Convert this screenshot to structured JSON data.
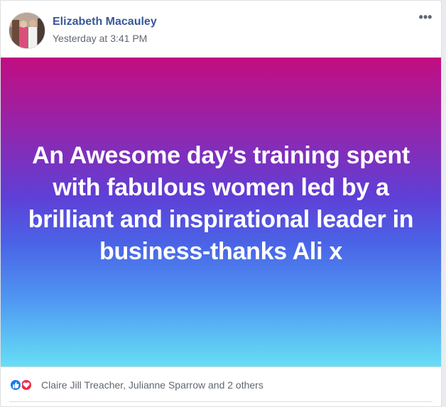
{
  "post": {
    "author": "Elizabeth Macauley",
    "timestamp": "Yesterday at 3:41 PM",
    "more_icon": "ellipsis-icon",
    "more_label": "•••",
    "status_text": "An Awesome day’s training spent with fabulous women led by a brilliant and inspirational leader in business-thanks Ali x",
    "background_gradient": [
      "#c20d80",
      "#5f3fd6",
      "#66dff5"
    ],
    "text_color": "#ffffff"
  },
  "reactions": {
    "icons": [
      "like-icon",
      "love-icon"
    ],
    "colors": {
      "like": "#1877f2",
      "love": "#f0284a"
    },
    "summary": "Claire Jill Treacher, Julianne Sparrow and 2 others"
  },
  "theme": {
    "author_color": "#385898",
    "meta_color": "#616770"
  }
}
